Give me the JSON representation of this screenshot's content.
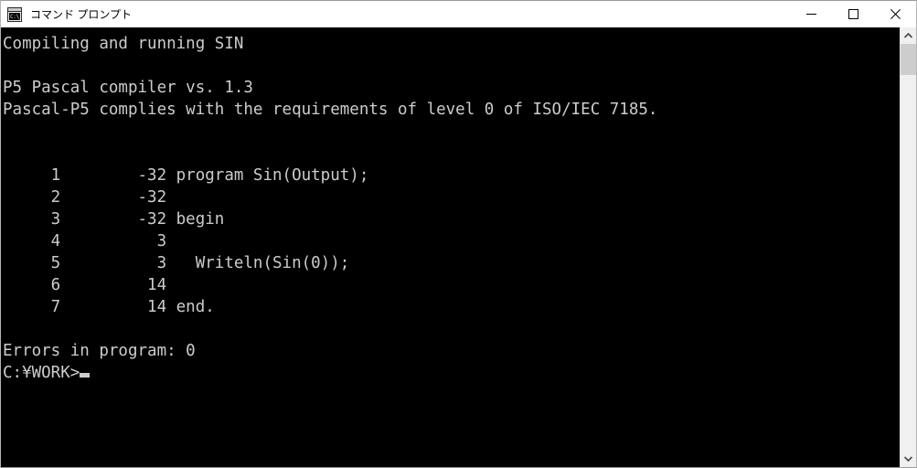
{
  "window": {
    "title": "コマンド プロンプト",
    "icon": "command-prompt-icon",
    "icon_glyph": "C:\\_",
    "controls": {
      "minimize": "minimize-button",
      "maximize": "maximize-button",
      "close": "close-button"
    }
  },
  "console": {
    "background_color": "#000000",
    "text_color": "#cccccc",
    "lines": [
      "Compiling and running SIN",
      "",
      "P5 Pascal compiler vs. 1.3",
      "Pascal-P5 complies with the requirements of level 0 of ISO/IEC 7185.",
      "",
      "",
      "     1        -32 program Sin(Output);",
      "     2        -32",
      "     3        -32 begin",
      "     4          3",
      "     5          3   Writeln(Sin(0));",
      "     6         14",
      "     7         14 end.",
      "",
      "Errors in program: 0"
    ],
    "prompt": "C:\\WORK>",
    "prompt_display": "C:¥WORK>",
    "cursor": "block-cursor",
    "listing": {
      "columns": [
        "line",
        "offset",
        "source"
      ],
      "rows": [
        {
          "line": "1",
          "offset": "-32",
          "source": "program Sin(Output);"
        },
        {
          "line": "2",
          "offset": "-32",
          "source": ""
        },
        {
          "line": "3",
          "offset": "-32",
          "source": "begin"
        },
        {
          "line": "4",
          "offset": "3",
          "source": ""
        },
        {
          "line": "5",
          "offset": "3",
          "source": "  Writeln(Sin(0));"
        },
        {
          "line": "6",
          "offset": "14",
          "source": ""
        },
        {
          "line": "7",
          "offset": "14",
          "source": "end."
        }
      ]
    },
    "messages": {
      "compiling": "Compiling and running SIN",
      "compiler_banner": "P5 Pascal compiler vs. 1.3",
      "standard_compliance": "Pascal-P5 complies with the requirements of level 0 of ISO/IEC 7185.",
      "errors": "Errors in program: 0",
      "error_count": "0"
    }
  },
  "scrollbar": {
    "up_arrow": "scroll-up-arrow",
    "down_arrow": "scroll-down-arrow",
    "thumb": "scroll-thumb"
  }
}
